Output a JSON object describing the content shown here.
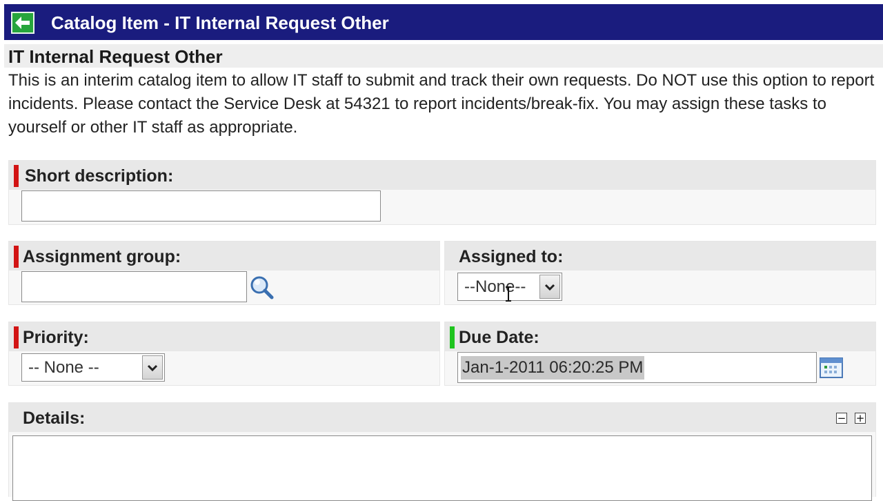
{
  "header": {
    "title": "Catalog Item - IT Internal Request Other",
    "back_icon": "back-arrow-icon",
    "bar_color": "#1a1c7e"
  },
  "intro": {
    "heading": "IT Internal Request Other",
    "text": "This is an interim catalog item to allow IT staff to submit and track their own requests.  Do NOT use this option to report incidents.  Please contact the Service Desk at 54321 to report incidents/break-fix.  You may assign these tasks to yourself or other IT staff as appropriate."
  },
  "form": {
    "short_description": {
      "label": "Short description:",
      "value": "",
      "mandatory": true
    },
    "assignment_group": {
      "label": "Assignment group:",
      "value": "",
      "mandatory": true,
      "lookup_icon": "magnifier-icon"
    },
    "assigned_to": {
      "label": "Assigned to:",
      "selected": "--None--"
    },
    "priority": {
      "label": "Priority:",
      "selected": "-- None --",
      "mandatory": true
    },
    "due_date": {
      "label": "Due Date:",
      "value": "Jan-1-2011 06:20:25 PM",
      "mandatory_filled": true,
      "picker_icon": "calendar-icon"
    },
    "details": {
      "label": "Details:",
      "value": "",
      "collapse_icon": "minus-icon",
      "expand_icon": "plus-icon"
    }
  },
  "colors": {
    "mandatory": "#d21414",
    "mandatory_filled": "#1ec41e"
  }
}
